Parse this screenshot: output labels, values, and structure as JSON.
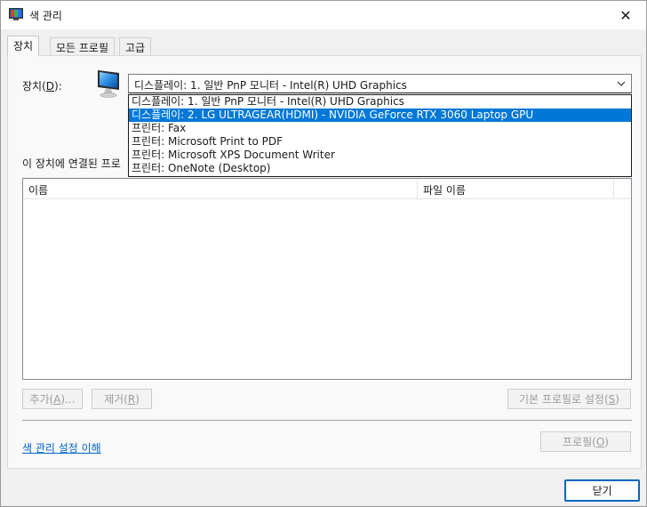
{
  "window": {
    "title": "색 관리",
    "close_glyph": "✕"
  },
  "tabs": [
    {
      "label": "장치",
      "active": true
    },
    {
      "label": "모든 프로필",
      "active": false
    },
    {
      "label": "고급",
      "active": false
    }
  ],
  "device": {
    "label_prefix": "장치(",
    "label_key": "D",
    "label_suffix": "):",
    "selected_value": "디스플레이: 1. 일반 PnP 모니터 - Intel(R) UHD Graphics",
    "options": [
      "디스플레이: 1. 일반 PnP 모니터 - Intel(R) UHD Graphics",
      "디스플레이: 2. LG ULTRAGEAR(HDMI) - NVIDIA GeForce RTX 3060 Laptop GPU",
      "프린터: Fax",
      "프린터: Microsoft Print to PDF",
      "프린터: Microsoft XPS Document Writer",
      "프린터: OneNote (Desktop)"
    ],
    "highlighted_index": 1
  },
  "profiles_section": {
    "label": "이 장치에 연결된 프로",
    "columns": [
      "이름",
      "파일 이름"
    ],
    "rows": []
  },
  "buttons": {
    "add": {
      "prefix": "추가(",
      "key": "A",
      "suffix": ")..."
    },
    "remove": {
      "prefix": "제거(",
      "key": "R",
      "suffix": ")"
    },
    "set_default": {
      "prefix": "기본 프로필로 설정(",
      "key": "S",
      "suffix": ")"
    },
    "profile": {
      "prefix": "프로필(",
      "key": "O",
      "suffix": ")"
    },
    "close": "닫기"
  },
  "link": {
    "label": "색 관리 설정 이해"
  },
  "colors": {
    "accent": "#0078d7",
    "link": "#0066cc",
    "disabled_text": "#9b9b9b"
  },
  "icons": {
    "title": "color-management-icon",
    "device": "monitor-icon",
    "combo": "chevron-down-icon",
    "close": "close-icon"
  }
}
